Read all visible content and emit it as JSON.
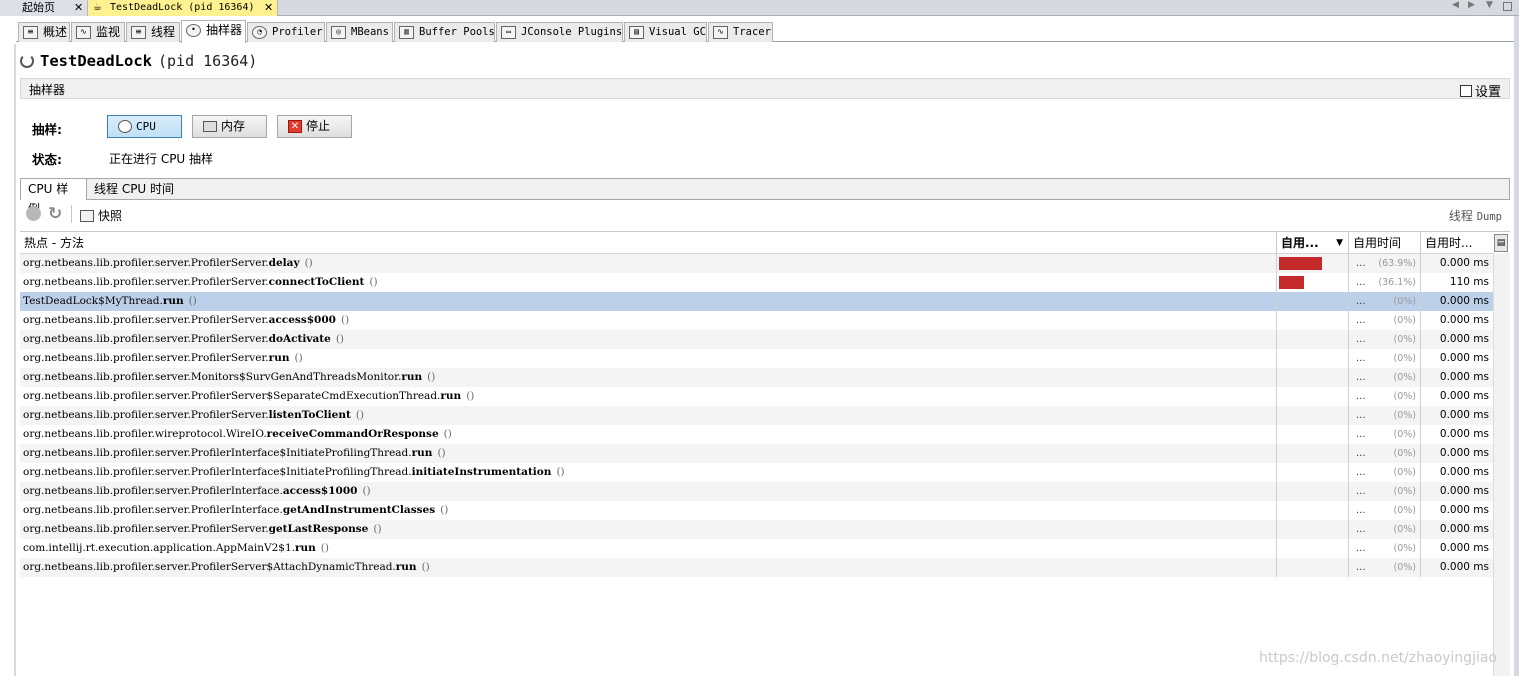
{
  "doc_tabs": [
    {
      "label": "起始页",
      "close": "✕"
    },
    {
      "label": "TestDeadLock (pid 16364)",
      "close": "✕"
    }
  ],
  "view_tabs": [
    {
      "label": "概述",
      "icon": "overview-icon"
    },
    {
      "label": "监视",
      "icon": "monitor-icon"
    },
    {
      "label": "线程",
      "icon": "threads-icon"
    },
    {
      "label": "抽样器",
      "icon": "sampler-icon"
    },
    {
      "label": "Profiler",
      "icon": "profiler-icon"
    },
    {
      "label": "MBeans",
      "icon": "mbeans-icon"
    },
    {
      "label": "Buffer Pools",
      "icon": "buffer-pools-icon"
    },
    {
      "label": "JConsole Plugins",
      "icon": "jconsole-icon"
    },
    {
      "label": "Visual GC",
      "icon": "visual-gc-icon"
    },
    {
      "label": "Tracer",
      "icon": "tracer-icon"
    }
  ],
  "app": {
    "name": "TestDeadLock",
    "pid": "(pid 16364)"
  },
  "sampler": {
    "header": "抽样器",
    "settings": "设置",
    "sample_label": "抽样:",
    "status_label": "状态:",
    "status_value": "正在进行 CPU 抽样",
    "buttons": {
      "cpu": "CPU",
      "memory": "内存",
      "stop": "停止"
    }
  },
  "sub_tabs": [
    "CPU 样例",
    "线程 CPU 时间"
  ],
  "toolbar": {
    "snapshot": "快照",
    "thread_dump_prefix": "线程",
    "thread_dump_suffix": "Dump"
  },
  "table": {
    "columns": [
      "热点 - 方法",
      "自用...",
      "自用时间",
      "自用时..."
    ],
    "rows": [
      {
        "prefix": "org.netbeans.lib.profiler.server.ProfilerServer.",
        "method": "delay",
        "bar": 0.639,
        "dots": "...",
        "pct": "(63.9%)",
        "time": "0.000 ms"
      },
      {
        "prefix": "org.netbeans.lib.profiler.server.ProfilerServer.",
        "method": "connectToClient",
        "bar": 0.361,
        "dots": "...",
        "pct": "(36.1%)",
        "time": "110 ms"
      },
      {
        "prefix": "TestDeadLock$MyThread.",
        "method": "run",
        "bar": 0,
        "dots": "...",
        "pct": "(0%)",
        "time": "0.000 ms"
      },
      {
        "prefix": "org.netbeans.lib.profiler.server.ProfilerServer.",
        "method": "access$000",
        "bar": 0,
        "dots": "...",
        "pct": "(0%)",
        "time": "0.000 ms"
      },
      {
        "prefix": "org.netbeans.lib.profiler.server.ProfilerServer.",
        "method": "doActivate",
        "bar": 0,
        "dots": "...",
        "pct": "(0%)",
        "time": "0.000 ms"
      },
      {
        "prefix": "org.netbeans.lib.profiler.server.ProfilerServer.",
        "method": "run",
        "bar": 0,
        "dots": "...",
        "pct": "(0%)",
        "time": "0.000 ms"
      },
      {
        "prefix": "org.netbeans.lib.profiler.server.Monitors$SurvGenAndThreadsMonitor.",
        "method": "run",
        "bar": 0,
        "dots": "...",
        "pct": "(0%)",
        "time": "0.000 ms"
      },
      {
        "prefix": "org.netbeans.lib.profiler.server.ProfilerServer$SeparateCmdExecutionThread.",
        "method": "run",
        "bar": 0,
        "dots": "...",
        "pct": "(0%)",
        "time": "0.000 ms"
      },
      {
        "prefix": "org.netbeans.lib.profiler.server.ProfilerServer.",
        "method": "listenToClient",
        "bar": 0,
        "dots": "...",
        "pct": "(0%)",
        "time": "0.000 ms"
      },
      {
        "prefix": "org.netbeans.lib.profiler.wireprotocol.WireIO.",
        "method": "receiveCommandOrResponse",
        "bar": 0,
        "dots": "...",
        "pct": "(0%)",
        "time": "0.000 ms"
      },
      {
        "prefix": "org.netbeans.lib.profiler.server.ProfilerInterface$InitiateProfilingThread.",
        "method": "run",
        "bar": 0,
        "dots": "...",
        "pct": "(0%)",
        "time": "0.000 ms"
      },
      {
        "prefix": "org.netbeans.lib.profiler.server.ProfilerInterface$InitiateProfilingThread.",
        "method": "initiateInstrumentation",
        "bar": 0,
        "dots": "...",
        "pct": "(0%)",
        "time": "0.000 ms"
      },
      {
        "prefix": "org.netbeans.lib.profiler.server.ProfilerInterface.",
        "method": "access$1000",
        "bar": 0,
        "dots": "...",
        "pct": "(0%)",
        "time": "0.000 ms"
      },
      {
        "prefix": "org.netbeans.lib.profiler.server.ProfilerInterface.",
        "method": "getAndInstrumentClasses",
        "bar": 0,
        "dots": "...",
        "pct": "(0%)",
        "time": "0.000 ms"
      },
      {
        "prefix": "org.netbeans.lib.profiler.server.ProfilerServer.",
        "method": "getLastResponse",
        "bar": 0,
        "dots": "...",
        "pct": "(0%)",
        "time": "0.000 ms"
      },
      {
        "prefix": "com.intellij.rt.execution.application.AppMainV2$1.",
        "method": "run",
        "bar": 0,
        "dots": "...",
        "pct": "(0%)",
        "time": "0.000 ms"
      },
      {
        "prefix": "org.netbeans.lib.profiler.server.ProfilerServer$AttachDynamicThread.",
        "method": "run",
        "bar": 0,
        "dots": "...",
        "pct": "(0%)",
        "time": "0.000 ms"
      }
    ],
    "selected_row": 2,
    "parens": "()"
  },
  "colors": {
    "bar": "#c52a2a",
    "selection": "#bdd0ea",
    "active_doc_tab": "#fdf28f"
  },
  "watermark": "https://blog.csdn.net/zhaoyingjiao"
}
